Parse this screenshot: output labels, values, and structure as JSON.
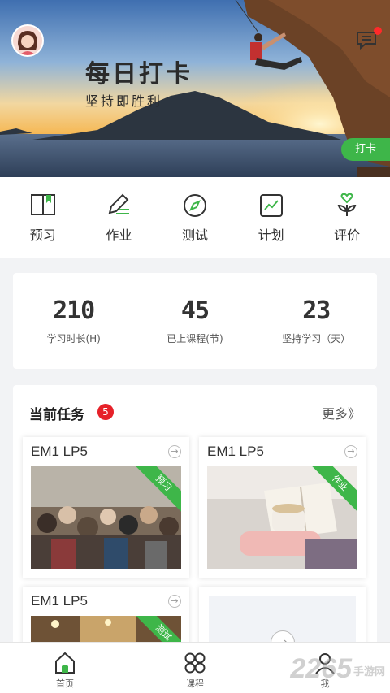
{
  "hero": {
    "title": "每日打卡",
    "subtitle": "坚持即胜利",
    "checkin_label": "打卡"
  },
  "quick_actions": [
    {
      "label": "预习",
      "icon": "book-icon"
    },
    {
      "label": "作业",
      "icon": "pencil-icon"
    },
    {
      "label": "测试",
      "icon": "compass-icon"
    },
    {
      "label": "计划",
      "icon": "chart-icon"
    },
    {
      "label": "评价",
      "icon": "heart-plant-icon"
    }
  ],
  "stats": [
    {
      "value": "210",
      "label": "学习时长(H)"
    },
    {
      "value": "45",
      "label": "已上课程(节)"
    },
    {
      "value": "23",
      "label": "坚持学习（天）"
    }
  ],
  "tasks": {
    "title": "当前任务",
    "count": "5",
    "more_label": "更多》",
    "cards": [
      {
        "title": "EM1 LP5",
        "tag": "预习",
        "image": "crowd-photo"
      },
      {
        "title": "EM1 LP5",
        "tag": "作业",
        "image": "reading-photo"
      },
      {
        "title": "EM1 LP5",
        "tag": "测试",
        "image": "street-photo"
      }
    ]
  },
  "bottom_nav": [
    {
      "label": "首页",
      "icon": "home-icon"
    },
    {
      "label": "课程",
      "icon": "grid-icon"
    },
    {
      "label": "我",
      "icon": "user-icon"
    }
  ],
  "watermark": {
    "text": "2265",
    "suffix": "手游网"
  },
  "colors": {
    "accent": "#3eb649",
    "badge": "#e62129"
  }
}
